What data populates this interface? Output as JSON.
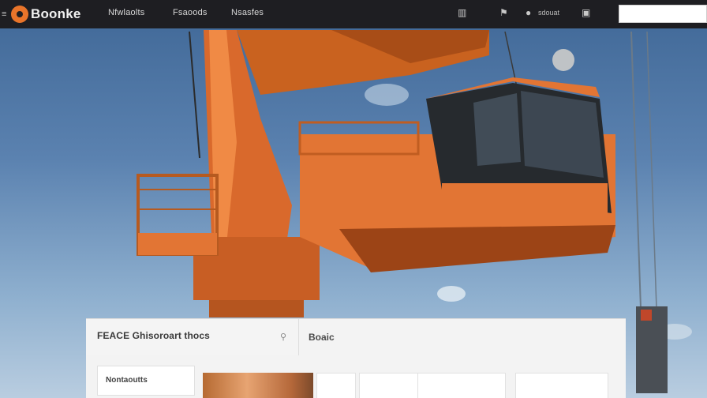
{
  "brand": {
    "name": "Boonke",
    "accent": "#e8742a"
  },
  "nav": {
    "links": [
      "Nfwlaolts",
      "Fsaoods",
      "Nsasfes"
    ],
    "right_icons": [
      "chat-icon",
      "flag-icon",
      "globe-icon",
      "cart-icon"
    ],
    "account_label": "sdouat"
  },
  "top_search": {
    "placeholder": ""
  },
  "search_panel": {
    "title": "FEACE Ghisoroart thocs",
    "right_label": "Boaic",
    "results_button": "Nontaoutts"
  },
  "colors": {
    "topbar": "#1e1e22",
    "crane_orange": "#e27534",
    "sky": "#4a72a0"
  }
}
